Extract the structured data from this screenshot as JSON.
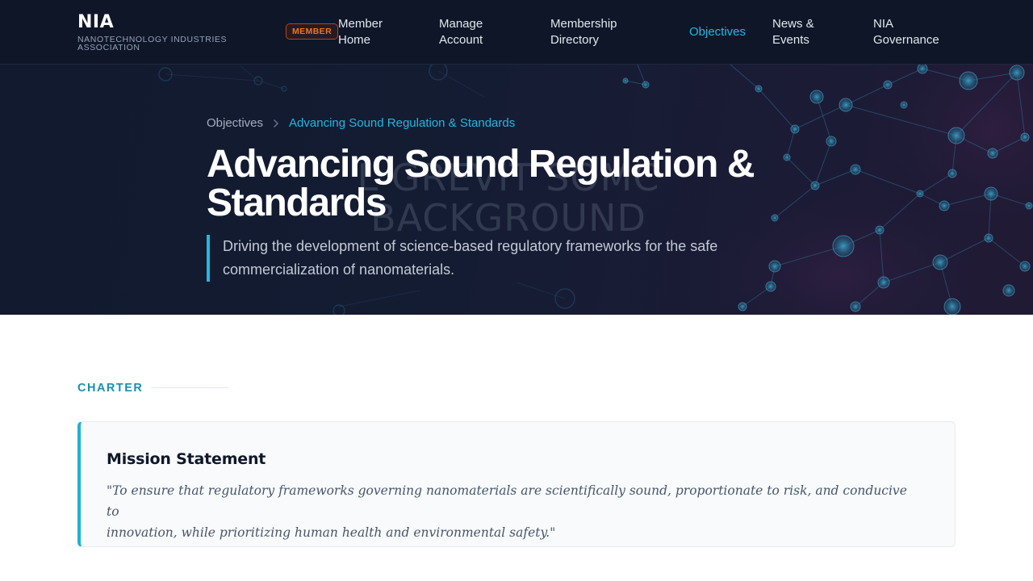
{
  "brand": {
    "name": "NIA",
    "subtitle": "NANOTECHNOLOGY INDUSTRIES ASSOCIATION"
  },
  "nav": {
    "badge": "MEMBER",
    "items": [
      {
        "line1": "Member",
        "line2": "Home"
      },
      {
        "line1": "Manage",
        "line2": "Account"
      },
      {
        "line1": "Membership",
        "line2": "Directory"
      },
      {
        "line1": "Objectives",
        "line2": ""
      },
      {
        "line1": "News &",
        "line2": "Events"
      },
      {
        "line1": "NIA",
        "line2": "Governance"
      }
    ],
    "active": "Objectives"
  },
  "hero": {
    "watermark_line1": "L GREVIT SOMC",
    "watermark_line2": "BACKGROUND",
    "breadcrumb": {
      "parent": "Objectives",
      "current": "Advancing Sound Regulation & Standards"
    },
    "title_line1": "Advancing Sound Regulation &",
    "title_line2": "Standards",
    "lead_line1": "Driving the development of science-based regulatory frameworks for the safe",
    "lead_line2": "commercialization of nanomaterials."
  },
  "content": {
    "section_label": "CHARTER",
    "mission": {
      "title": "Mission Statement",
      "quote_line1": "\"To ensure that regulatory frameworks governing nanomaterials are scientifically sound, proportionate to risk, and conducive to",
      "quote_line2": "innovation, while prioritizing human health and environmental safety.\""
    }
  },
  "colors": {
    "nav_bg": "#0e1628",
    "accent": "#22b8de",
    "badge": "#f97316",
    "section_label": "#1a8fb0",
    "card_bg": "#f8fafc"
  }
}
